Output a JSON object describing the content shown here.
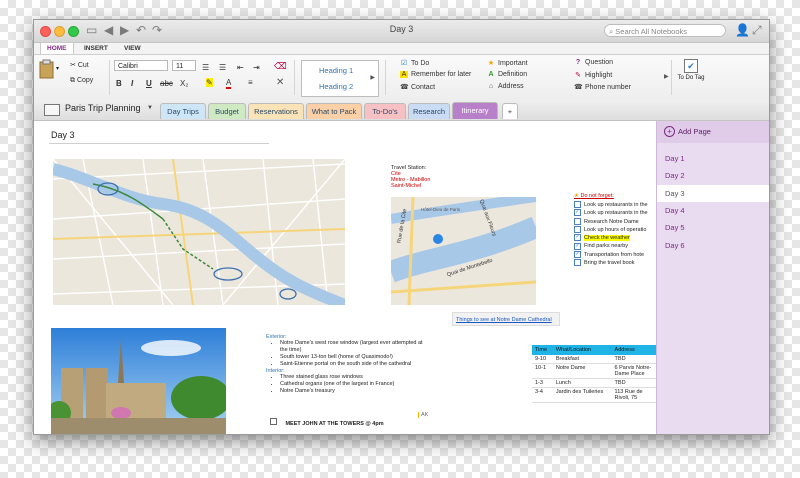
{
  "window": {
    "title": "Day 3",
    "search_placeholder": "Search All Notebooks"
  },
  "ribbon_tabs": [
    "HOME",
    "INSERT",
    "VIEW"
  ],
  "ribbon": {
    "paste": "Paste",
    "cut": "Cut",
    "copy": "Copy",
    "font": "Calibri",
    "size": "11",
    "format_buttons": [
      "B",
      "I",
      "U",
      "abc",
      "X₂"
    ],
    "styles": [
      "Heading 1",
      "Heading 2"
    ],
    "tags": [
      {
        "label": "To Do",
        "icon": "checkbox-icon"
      },
      {
        "label": "Remember for later",
        "icon": "highlight-a-icon"
      },
      {
        "label": "Contact",
        "icon": "phone-icon"
      },
      {
        "label": "Important",
        "icon": "star-icon"
      },
      {
        "label": "Definition",
        "icon": "green-a-icon"
      },
      {
        "label": "Address",
        "icon": "house-icon"
      },
      {
        "label": "Question",
        "icon": "question-icon"
      },
      {
        "label": "Highlight",
        "icon": "pen-icon"
      },
      {
        "label": "Phone number",
        "icon": "phone-icon"
      }
    ],
    "todo_tag": "To Do Tag"
  },
  "notebook": {
    "name": "Paris Trip Planning"
  },
  "sections": [
    {
      "label": "Day Trips",
      "color": "#cfe6f7"
    },
    {
      "label": "Budget",
      "color": "#cfe9c2"
    },
    {
      "label": "Reservations",
      "color": "#fbe3b8"
    },
    {
      "label": "What to Pack",
      "color": "#fbd0a6"
    },
    {
      "label": "To-Do's",
      "color": "#f7c1c4"
    },
    {
      "label": "Research",
      "color": "#c9dcf3"
    },
    {
      "label": "Itinerary",
      "color": "#b880c8"
    }
  ],
  "add_section": "+",
  "page": {
    "title": "Day 3",
    "train_station": [
      "Travel Station:",
      "Cite",
      "Metro - Mabillon",
      "Saint-Michel"
    ],
    "map_labels": [
      "Quai de Montebello",
      "Quai aux Fleurs",
      "Rue de la Cite",
      "Hôtel-Dieu de Paris"
    ],
    "link": "Things to see at Notre Dame Cathedral",
    "do_not_forget": {
      "title": "Do not forget:",
      "items": [
        {
          "text": "Look up restaurants in the",
          "checked": false,
          "highlight": false
        },
        {
          "text": "Look up restaurants in the",
          "checked": true,
          "highlight": false
        },
        {
          "text": "Research Notre Dame",
          "checked": false,
          "highlight": false
        },
        {
          "text": "Look up hours of operatio",
          "checked": false,
          "highlight": false
        },
        {
          "text": "Check the weather",
          "checked": true,
          "highlight": true
        },
        {
          "text": "Find parks nearby",
          "checked": true,
          "highlight": false
        },
        {
          "text": "Transportation from hote",
          "checked": true,
          "highlight": false
        },
        {
          "text": "Bring the travel book",
          "checked": false,
          "highlight": false
        }
      ]
    },
    "exterior_title": "Exterior:",
    "exterior": [
      "Notre Dame's west rose window (largest ever attempted at the time)",
      "South tower 13-ton bell (home of Quasimodo!)",
      "Saint-Etienne portal on the south side of the cathedral"
    ],
    "interior_title": "Interior:",
    "interior": [
      "Three stained glass rose windows",
      "Cathedral organs (one of the largest in France)",
      "Notre Dame's treasury"
    ],
    "meet": "MEET JOHN AT THE TOWERS @ 4pm",
    "initials": "AK",
    "schedule": {
      "headers": [
        "Time",
        "What/Location",
        "Address"
      ],
      "rows": [
        [
          "9-10",
          "Breakfast",
          "TBD"
        ],
        [
          "10-1",
          "Notre Dame",
          "6 Parvis Notre-Dame Place"
        ],
        [
          "1-3",
          "Lunch",
          "TBD"
        ],
        [
          "3-4",
          "Jardin des Tuileries",
          "113 Rue de Rivoli, 75"
        ]
      ]
    }
  },
  "pages_panel": {
    "add": "Add Page",
    "pages": [
      "Day 1",
      "Day 2",
      "Day 3",
      "Day 4",
      "Day 5",
      "Day 6"
    ],
    "active": 2
  }
}
